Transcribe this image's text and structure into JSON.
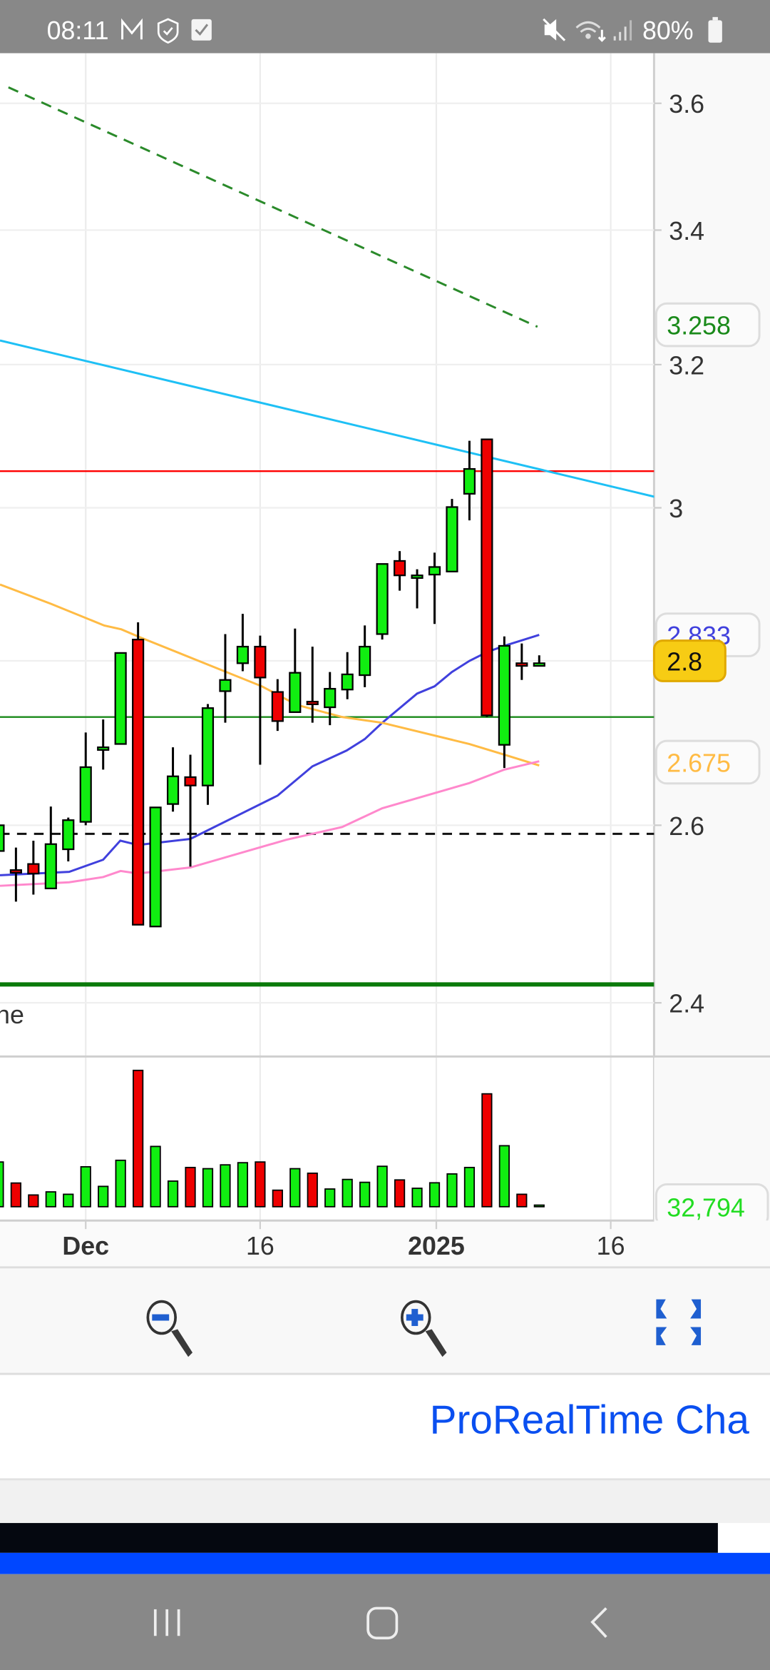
{
  "status_bar": {
    "time": "08:11",
    "battery": "80%",
    "icons": [
      "gmail-icon",
      "shield-check-icon",
      "checkbox-icon",
      "mute-icon",
      "wifi-icon",
      "signal-icon",
      "battery-icon"
    ]
  },
  "chart_data": {
    "type": "candlestick",
    "legend_fragment": "ne",
    "price_axis": {
      "scale": "log",
      "range": [
        2.35,
        3.72
      ],
      "ticks": [
        {
          "value": 3.6,
          "label": "3.6"
        },
        {
          "value": 3.4,
          "label": "3.4"
        },
        {
          "value": 3.2,
          "label": "3.2"
        },
        {
          "value": 3.0,
          "label": "3"
        },
        {
          "value": 2.8,
          "label": "2.8"
        },
        {
          "value": 2.6,
          "label": "2.6"
        },
        {
          "value": 2.4,
          "label": "2.4"
        }
      ]
    },
    "x_axis": {
      "labels": [
        {
          "text": "Dec",
          "index": 5,
          "bold": true
        },
        {
          "text": "16",
          "index": 15,
          "bold": false
        },
        {
          "text": "2025",
          "index": 25.1,
          "bold": true
        },
        {
          "text": "16",
          "index": 35.1,
          "bold": false
        }
      ]
    },
    "candles_format": [
      "open",
      "high",
      "low",
      "close",
      "volume"
    ],
    "candles": [
      [
        2.57,
        2.64,
        2.55,
        2.6,
        2044000
      ],
      [
        2.548,
        2.574,
        2.512,
        2.547,
        1082000
      ],
      [
        2.555,
        2.582,
        2.52,
        2.544,
        536000
      ],
      [
        2.527,
        2.622,
        2.527,
        2.578,
        678000
      ],
      [
        2.572,
        2.609,
        2.558,
        2.606,
        568000
      ],
      [
        2.604,
        2.711,
        2.6,
        2.669,
        1825000
      ],
      [
        2.692,
        2.727,
        2.666,
        2.693,
        929000
      ],
      [
        2.697,
        2.81,
        2.697,
        2.81,
        2121000
      ],
      [
        2.827,
        2.849,
        2.486,
        2.486,
        6231000
      ],
      [
        2.484,
        2.621,
        2.484,
        2.621,
        2755000
      ],
      [
        2.625,
        2.693,
        2.616,
        2.658,
        1170000
      ],
      [
        2.657,
        2.684,
        2.552,
        2.647,
        1793000
      ],
      [
        2.647,
        2.746,
        2.624,
        2.741,
        1738000
      ],
      [
        2.762,
        2.834,
        2.723,
        2.776,
        1913000
      ],
      [
        2.797,
        2.86,
        2.787,
        2.818,
        2011000
      ],
      [
        2.818,
        2.832,
        2.672,
        2.779,
        2044000
      ],
      [
        2.761,
        2.777,
        2.713,
        2.725,
        754000
      ],
      [
        2.736,
        2.841,
        2.736,
        2.785,
        1738000
      ],
      [
        2.749,
        2.818,
        2.723,
        2.748,
        1530000
      ],
      [
        2.742,
        2.786,
        2.72,
        2.765,
        809000
      ],
      [
        2.764,
        2.811,
        2.752,
        2.783,
        1246000
      ],
      [
        2.782,
        2.845,
        2.767,
        2.818,
        1115000
      ],
      [
        2.834,
        2.925,
        2.827,
        2.925,
        1847000
      ],
      [
        2.929,
        2.942,
        2.89,
        2.91,
        1224000
      ],
      [
        2.908,
        2.918,
        2.867,
        2.91,
        842000
      ],
      [
        2.911,
        2.94,
        2.847,
        2.921,
        1093000
      ],
      [
        2.915,
        3.012,
        2.915,
        3.001,
        1498000
      ],
      [
        3.019,
        3.092,
        2.983,
        3.053,
        1793000
      ],
      [
        3.094,
        3.094,
        2.73,
        2.732,
        5159000
      ],
      [
        2.696,
        2.831,
        2.668,
        2.819,
        2787000
      ],
      [
        2.797,
        2.822,
        2.776,
        2.795,
        568000
      ],
      [
        2.795,
        2.807,
        2.794,
        2.797,
        32794
      ]
    ],
    "moving_averages": [
      {
        "name": "ma-blue",
        "color": "#4040dd",
        "label": "2.833",
        "points": [
          [
            0.085,
            2.542
          ],
          [
            4.05,
            2.546
          ],
          [
            6.0,
            2.56
          ],
          [
            6.98,
            2.582
          ],
          [
            8.0,
            2.577
          ],
          [
            11.0,
            2.584
          ],
          [
            16.0,
            2.635
          ],
          [
            18.0,
            2.67
          ],
          [
            19.96,
            2.689
          ],
          [
            21.0,
            2.703
          ],
          [
            22.0,
            2.723
          ],
          [
            24.0,
            2.759
          ],
          [
            25.0,
            2.768
          ],
          [
            26.0,
            2.786
          ],
          [
            27.0,
            2.8
          ],
          [
            28.0,
            2.811
          ],
          [
            29.0,
            2.819
          ],
          [
            31.0,
            2.833
          ]
        ]
      },
      {
        "name": "ma-orange",
        "color": "#ffbb44",
        "label": "2.675",
        "points": [
          [
            0.085,
            2.898
          ],
          [
            3.0,
            2.873
          ],
          [
            6.06,
            2.845
          ],
          [
            7.04,
            2.84
          ],
          [
            8.0,
            2.831
          ],
          [
            15.1,
            2.768
          ],
          [
            17.1,
            2.745
          ],
          [
            19.7,
            2.73
          ],
          [
            21.98,
            2.723
          ],
          [
            27.0,
            2.697
          ],
          [
            29.0,
            2.684
          ],
          [
            31.0,
            2.671
          ]
        ]
      },
      {
        "name": "ma-pink",
        "color": "#ff88cc",
        "label": "",
        "points": [
          [
            0.085,
            2.53
          ],
          [
            4.05,
            2.534
          ],
          [
            6.0,
            2.54
          ],
          [
            7.0,
            2.547
          ],
          [
            8.0,
            2.544
          ],
          [
            11.0,
            2.551
          ],
          [
            16.5,
            2.583
          ],
          [
            19.7,
            2.598
          ],
          [
            22.0,
            2.62
          ],
          [
            27.0,
            2.65
          ],
          [
            29.0,
            2.666
          ],
          [
            31.0,
            2.676
          ]
        ]
      }
    ],
    "trendlines": [
      {
        "name": "cyan-trendline",
        "color": "#1ec0f5",
        "dashed": false,
        "from": [
          0.085,
          3.235
        ],
        "to": [
          37.6,
          3.015
        ]
      },
      {
        "name": "green-dashed-trendline",
        "color": "#2a8a2a",
        "dashed": true,
        "from": [
          0.57,
          3.626
        ],
        "to": [
          30.9,
          3.255
        ]
      }
    ],
    "horizontal_lines": [
      {
        "name": "red-resistance-line",
        "price": 3.05,
        "color": "#ff0000",
        "dashed": false,
        "weight": "thin"
      },
      {
        "name": "green-support-line",
        "price": 2.73,
        "color": "#1a8a1a",
        "dashed": false,
        "weight": "thin"
      },
      {
        "name": "black-dashed-line",
        "price": 2.59,
        "color": "#111111",
        "dashed": true,
        "weight": "medium"
      },
      {
        "name": "thick-green-line",
        "price": 2.42,
        "color": "#0a7a0a",
        "dashed": false,
        "weight": "thick"
      }
    ],
    "badges": [
      {
        "name": "trendline-value-badge",
        "text": "3.258",
        "color": "#1a8a1a",
        "price": 3.258
      },
      {
        "name": "ma-blue-value-badge",
        "text": "2.833",
        "color": "#4040dd",
        "price": 2.833
      },
      {
        "name": "ma-orange-value-badge",
        "text": "2.675",
        "color": "#ffbb44",
        "price": 2.675
      }
    ],
    "last_price": {
      "text": "2.8",
      "bg": "#f7cc14",
      "price": 2.8
    },
    "volume_label": {
      "text": "32,794",
      "color": "#22dd22"
    },
    "colors": {
      "up": "#11ee11",
      "down": "#ee0000"
    }
  },
  "toolbar": {
    "zoom_out": "zoom-out-icon",
    "zoom_in": "zoom-in-icon",
    "fullscreen": "fullscreen-icon"
  },
  "banner": {
    "text": "ProRealTime Cha"
  }
}
